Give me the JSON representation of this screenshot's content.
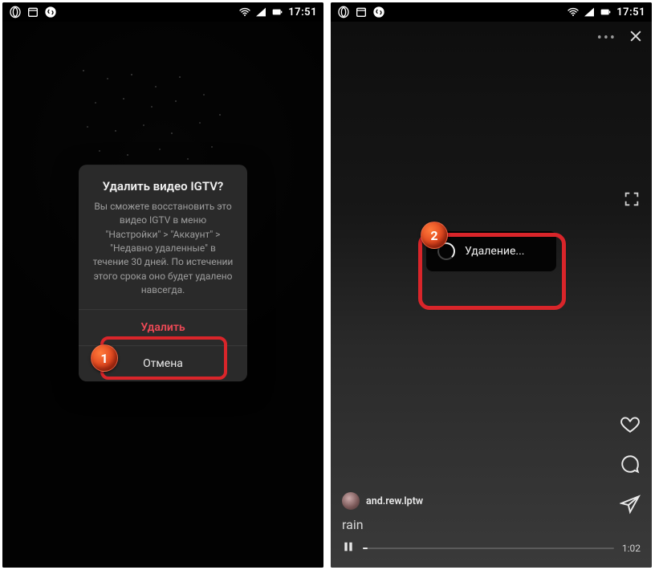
{
  "statusbar": {
    "time": "17:51"
  },
  "left": {
    "dialog": {
      "title": "Удалить видео IGTV?",
      "body": "Вы сможете восстановить это видео IGTV в меню \"Настройки\" > \"Аккаунт\" > \"Недавно удаленные\" в течение 30 дней. По истечении этого срока оно будет удалено навсегда.",
      "delete": "Удалить",
      "cancel": "Отмена"
    },
    "marker": "1"
  },
  "right": {
    "toast": "Удаление...",
    "username": "and.rew.lptw",
    "caption": "rain",
    "time": "1:02",
    "marker": "2"
  }
}
